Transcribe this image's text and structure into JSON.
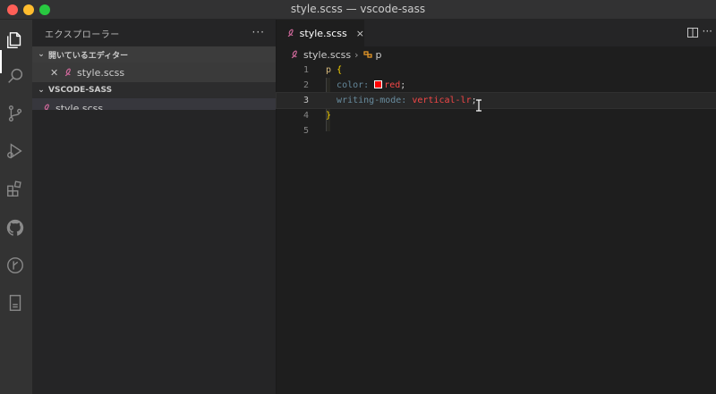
{
  "window": {
    "title": "style.scss — vscode-sass"
  },
  "activity_bar": {
    "icons": [
      "files-icon",
      "search-icon",
      "source-control-icon",
      "run-debug-icon",
      "extensions-icon",
      "github-icon",
      "git-graph-icon",
      "remote-explorer-icon"
    ]
  },
  "sidebar": {
    "header": "エクスプローラー",
    "more": "···",
    "open_editors": {
      "label": "開いているエディター",
      "items": [
        {
          "name": "style.scss"
        }
      ]
    },
    "project": {
      "label": "VSCODE-SASS",
      "files": [
        {
          "name": "style.scss"
        }
      ]
    }
  },
  "editor": {
    "tab": {
      "label": "style.scss",
      "close": "×"
    },
    "more": "···",
    "breadcrumb": {
      "file": "style.scss",
      "symbol": "p"
    },
    "lines": [
      {
        "n": "1",
        "selector": "p",
        "brace": "{"
      },
      {
        "n": "2",
        "property": "color:",
        "value": "red",
        "semi": ";"
      },
      {
        "n": "3",
        "property": "writing-mode:",
        "value": "vertical-lr",
        "semi": ";"
      },
      {
        "n": "4",
        "brace": "}"
      },
      {
        "n": "5"
      }
    ]
  },
  "colors": {
    "accent_red_swatch": "#ff0000",
    "sass_pink": "#cd6799"
  }
}
